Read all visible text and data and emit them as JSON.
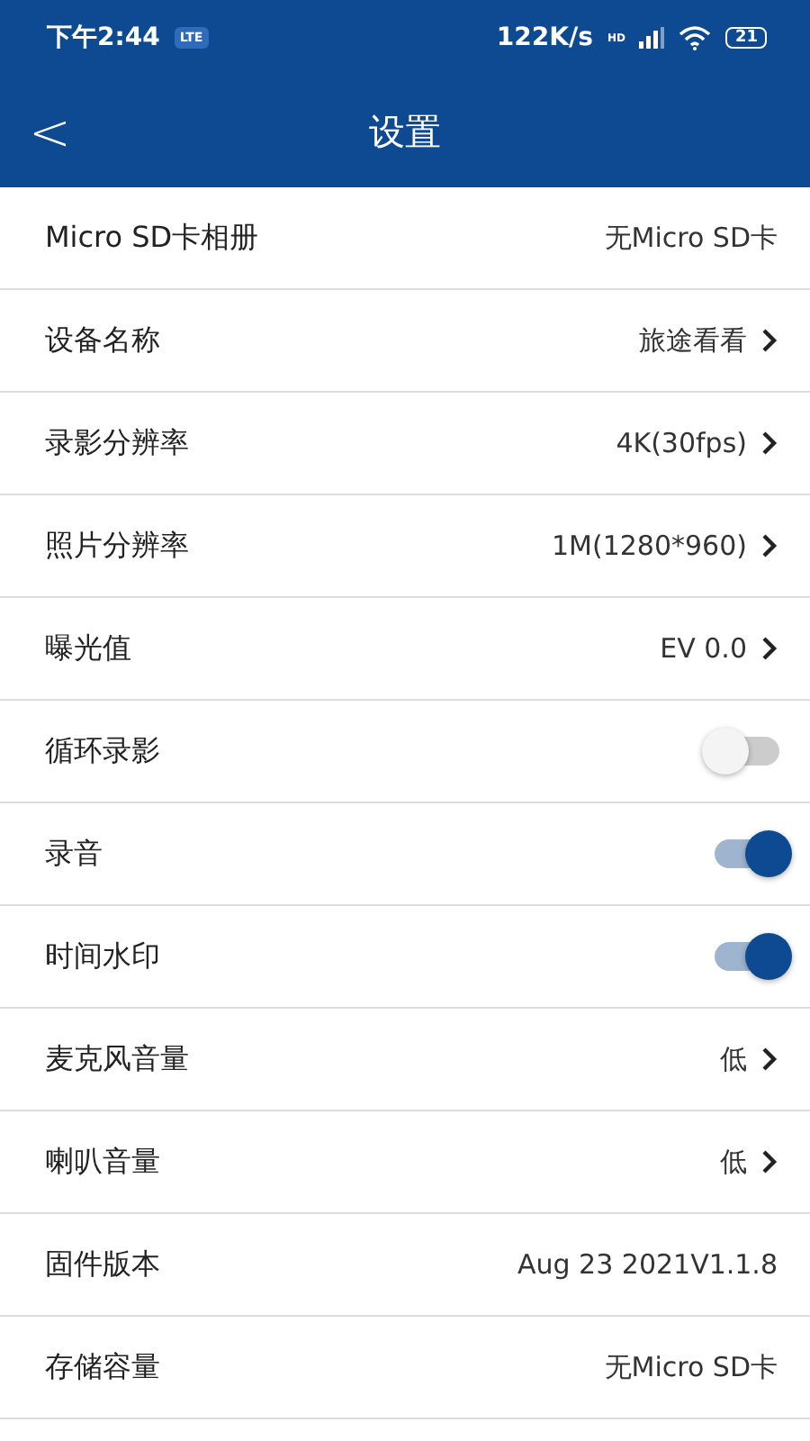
{
  "status_bar": {
    "time": "下午2:44",
    "badge": "LTE",
    "speed": "122K/s",
    "network": "HD",
    "battery": "21"
  },
  "header": {
    "back": "<",
    "title": "设置"
  },
  "rows": [
    {
      "kind": "value",
      "label": "Micro SD卡相册",
      "value": "无Micro SD卡"
    },
    {
      "kind": "link",
      "label": "设备名称",
      "value": "旅途看看"
    },
    {
      "kind": "link",
      "label": "录影分辨率",
      "value": "4K(30fps)"
    },
    {
      "kind": "link",
      "label": "照片分辨率",
      "value": "1M(1280*960)"
    },
    {
      "kind": "link",
      "label": "曝光值",
      "value": "EV 0.0"
    },
    {
      "kind": "toggle",
      "label": "循环录影",
      "on": false
    },
    {
      "kind": "toggle",
      "label": "录音",
      "on": true
    },
    {
      "kind": "toggle",
      "label": "时间水印",
      "on": true
    },
    {
      "kind": "link",
      "label": "麦克风音量",
      "value": "低"
    },
    {
      "kind": "link",
      "label": "喇叭音量",
      "value": "低"
    },
    {
      "kind": "value",
      "label": "固件版本",
      "value": "Aug 23 2021V1.1.8"
    },
    {
      "kind": "value",
      "label": "存储容量",
      "value": "无Micro SD卡"
    }
  ]
}
